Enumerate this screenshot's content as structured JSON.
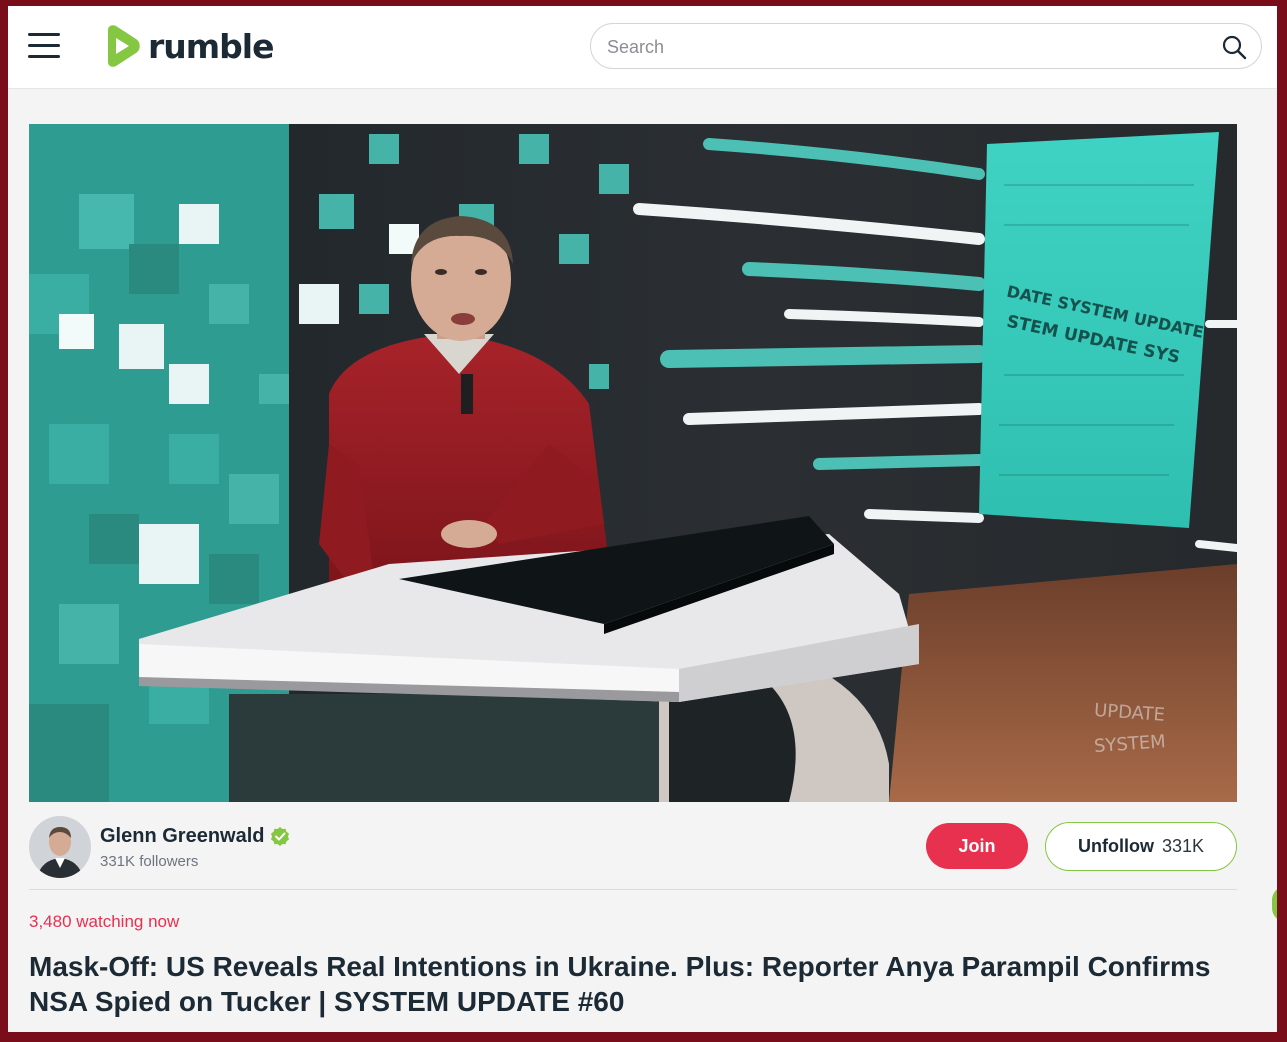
{
  "header": {
    "logo_text": "rumble",
    "search_placeholder": "Search"
  },
  "video": {
    "overlay_text_1": "UPDATE",
    "overlay_text_2": "SYSTEM",
    "screen_text_1": "DATE SYSTEM UPDATE",
    "screen_text_2": "STEM UPDATE SYS"
  },
  "channel": {
    "name": "Glenn Greenwald",
    "followers": "331K followers",
    "join_label": "Join",
    "unfollow_label": "Unfollow",
    "unfollow_count": "331K"
  },
  "stream": {
    "watching": "3,480 watching now",
    "title": "Mask-Off: US Reveals Real Intentions in Ukraine. Plus: Reporter Anya Parampil Confirms NSA Spied on Tucker | SYSTEM UPDATE #60"
  },
  "colors": {
    "brand_green": "#85c742",
    "join_red": "#e8304f",
    "text_dark": "#1c2a35",
    "frame_border": "#7a0d1a"
  }
}
